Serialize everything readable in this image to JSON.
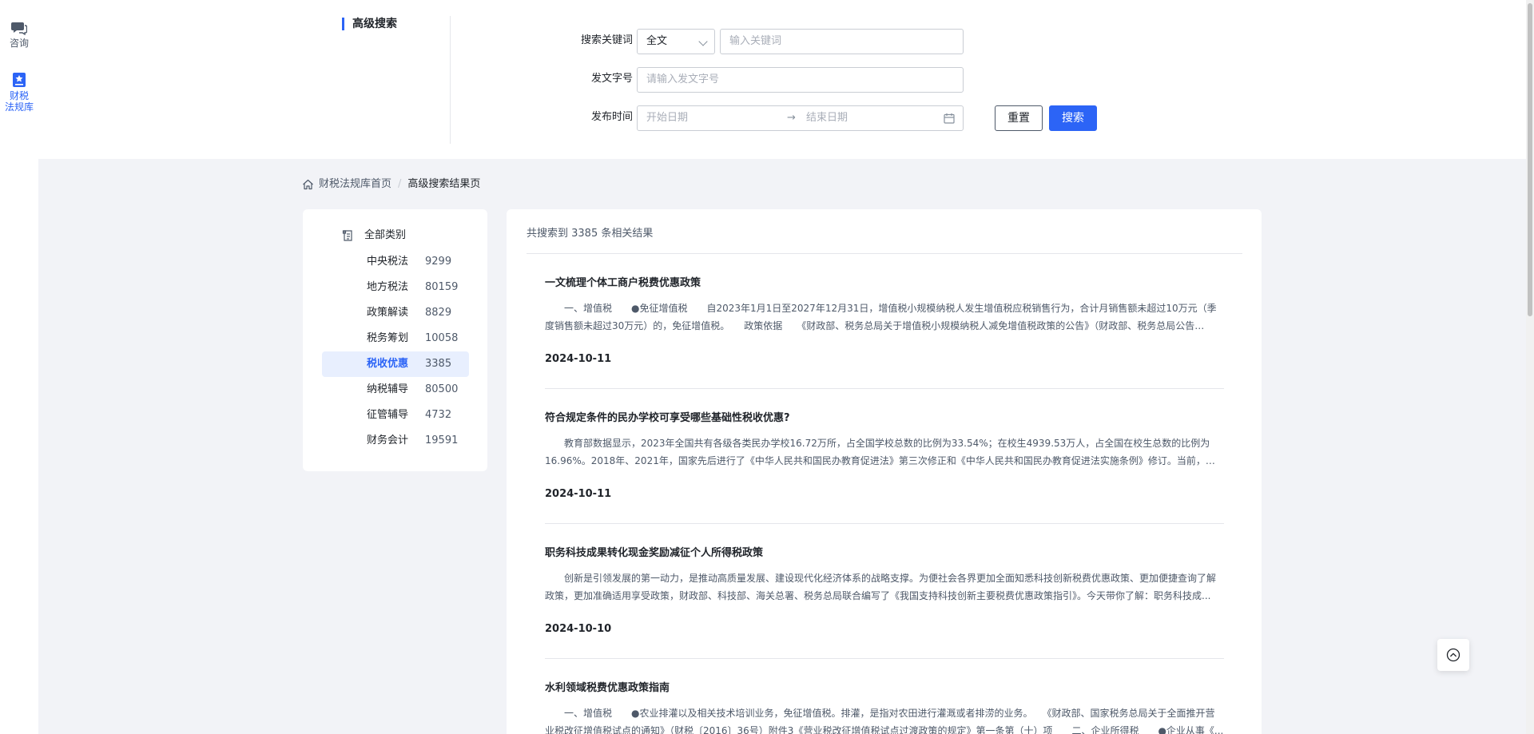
{
  "rail": {
    "items": [
      {
        "label": "咨询",
        "icon": "chat-icon"
      },
      {
        "label_line1": "财税",
        "label_line2": "法规库",
        "icon": "law-library-icon",
        "active": true
      }
    ]
  },
  "search": {
    "section_title": "高级搜索",
    "keyword_label": "搜索关键词",
    "scope_value": "全文",
    "keyword_placeholder": "输入关键词",
    "doc_number_label": "发文字号",
    "doc_number_placeholder": "请输入发文字号",
    "date_label": "发布时间",
    "start_date_placeholder": "开始日期",
    "date_arrow": "→",
    "end_date_placeholder": "结束日期",
    "reset_label": "重置",
    "search_label": "搜索"
  },
  "breadcrumb": {
    "home": "财税法规库首页",
    "separator": "/",
    "current": "高级搜索结果页"
  },
  "categories": {
    "all_label": "全部类别",
    "items": [
      {
        "name": "中央税法",
        "count": "9299"
      },
      {
        "name": "地方税法",
        "count": "80159"
      },
      {
        "name": "政策解读",
        "count": "8829"
      },
      {
        "name": "税务筹划",
        "count": "10058"
      },
      {
        "name": "税收优惠",
        "count": "3385",
        "active": true
      },
      {
        "name": "纳税辅导",
        "count": "80500"
      },
      {
        "name": "征管辅导",
        "count": "4732"
      },
      {
        "name": "财务会计",
        "count": "19591"
      }
    ]
  },
  "results": {
    "summary": "共搜索到 3385 条相关结果",
    "items": [
      {
        "title": "一文梳理个体工商户税费优惠政策",
        "snippet": "一、增值税　　●免征增值税　　自2023年1月1日至2027年12月31日，增值税小规模纳税人发生增值税应税销售行为，合计月销售额未超过10万元（季度销售额未超过30万元）的，免征增值税。　　政策依据　　《财政部、税务总局关于增值税小规模纳税人减免增值税政策的公告》（财政部、税务总局公告2023...",
        "date": "2024-10-11"
      },
      {
        "title": "符合规定条件的民办学校可享受哪些基础性税收优惠?",
        "snippet": "教育部数据显示，2023年全国共有各级各类民办学校16.72万所，占全国学校总数的比例为33.54%；在校生4939.53万人，占全国在校生总数的比例为16.96%。2018年、2021年，国家先后进行了《中华人民共和国民办教育促进法》第三次修正和《中华人民共和国民办教育促进法实施条例》修订。当前，国内民办...",
        "date": "2024-10-11"
      },
      {
        "title": "职务科技成果转化现金奖励减征个人所得税政策",
        "snippet": "创新是引领发展的第一动力，是推动高质量发展、建设现代化经济体系的战略支撑。为便社会各界更加全面知悉科技创新税费优惠政策、更加便捷查询了解政策，更加准确适用享受政策，财政部、科技部、海关总署、税务总局联合编写了《我国支持科技创新主要税费优惠政策指引》。今天带你了解：职务科技成...",
        "date": "2024-10-10"
      },
      {
        "title": "水利领域税费优惠政策指南",
        "snippet": "一、增值税　　●农业排灌以及相关技术培训业务，免征增值税。排灌，是指对农田进行灌溉或者排涝的业务。　　《财政部、国家税务总局关于全面推开营业税改征增值税试点的通知》（财税〔2016〕36号）附件3《营业税改征增值税试点过渡政策的规定》第一条第（十）项　　二、企业所得税　　●企业从事《...",
        "date": ""
      }
    ]
  }
}
